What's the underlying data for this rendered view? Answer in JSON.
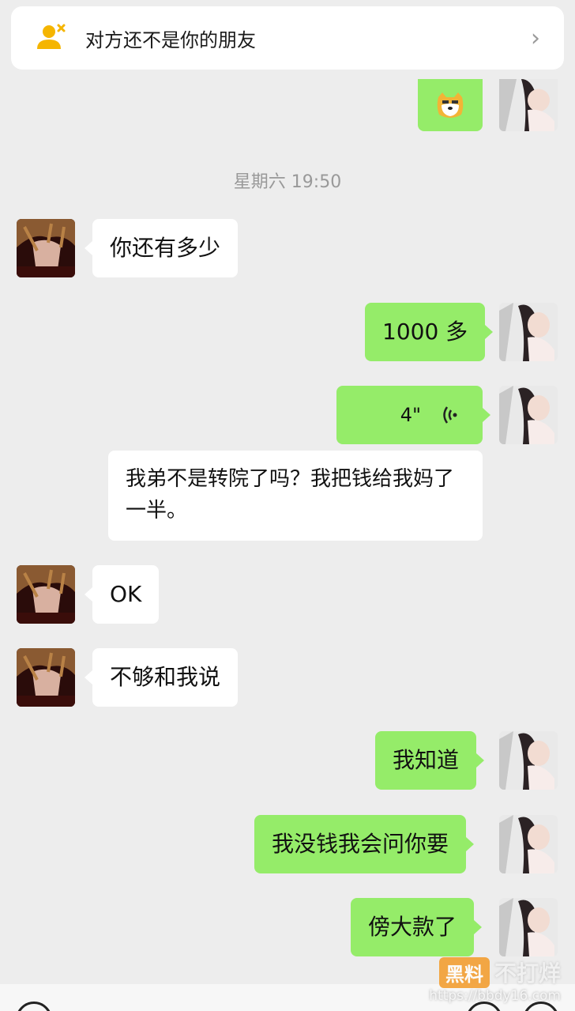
{
  "banner": {
    "text": "对方还不是你的朋友",
    "chevron": "›"
  },
  "timestamp": "星期六 19:50",
  "messages": {
    "m1": "你还有多少",
    "m2": "1000 多",
    "m3_voice_duration": "4\"",
    "m4": "我弟不是转院了吗？我把钱给我妈了一半。",
    "m5": "OK",
    "m6": "不够和我说",
    "m7": "我知道",
    "m8": "我没钱我会问你要",
    "m9": "傍大款了"
  },
  "watermark": {
    "badge": "黑料",
    "name": "不打烊",
    "url": "https://bbdy16.com"
  },
  "colors": {
    "background": "#ededed",
    "green_bubble": "#95ec69",
    "white_bubble": "#ffffff"
  },
  "icons": {
    "banner": "user-remove-icon",
    "voice": "voice-wave-icon",
    "emoji": "doge-emoji-icon"
  }
}
